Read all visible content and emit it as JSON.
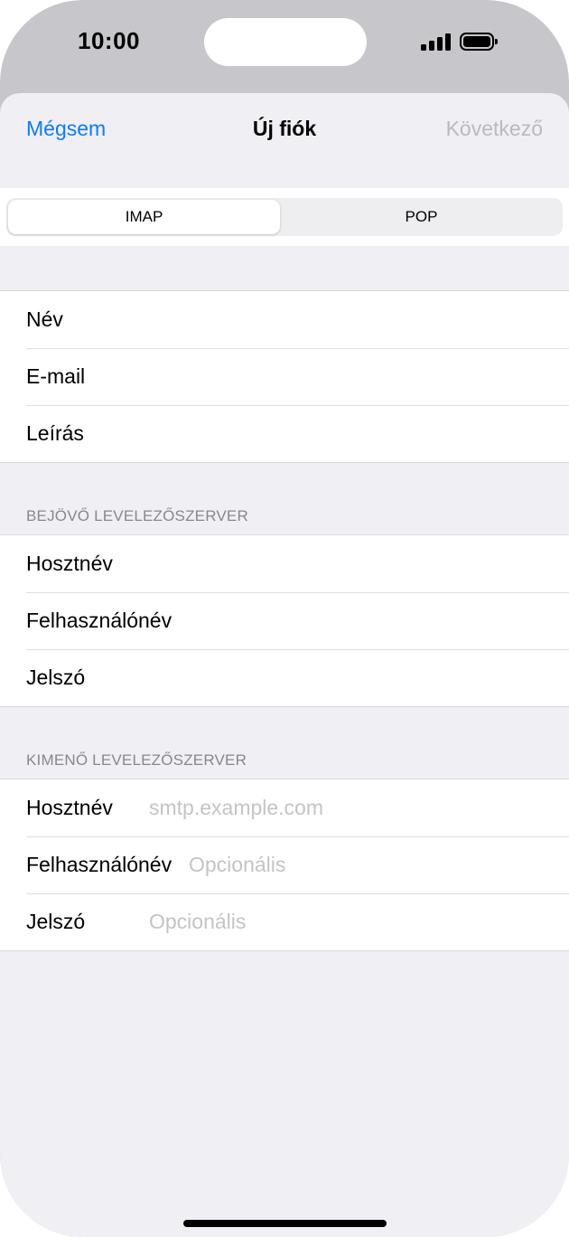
{
  "status_bar": {
    "time": "10:00"
  },
  "nav": {
    "cancel": "Mégsem",
    "title": "Új fiók",
    "next": "Következő"
  },
  "segmented": {
    "options": [
      "IMAP",
      "POP"
    ],
    "selected": "IMAP"
  },
  "account_fields": {
    "name": "Név",
    "email": "E-mail",
    "description": "Leírás"
  },
  "incoming": {
    "header": "BEJÖVŐ LEVELEZŐSZERVER",
    "hostname": "Hosztnév",
    "username": "Felhasználónév",
    "password": "Jelszó"
  },
  "outgoing": {
    "header": "KIMENŐ LEVELEZŐSZERVER",
    "hostname": "Hosztnév",
    "hostname_placeholder": "smtp.example.com",
    "username": "Felhasználónév",
    "username_placeholder": "Opcionális",
    "password": "Jelszó",
    "password_placeholder": "Opcionális"
  },
  "colors": {
    "accent": "#0a7cff",
    "disabled": "#b9b9be",
    "background": "#f0eff4"
  }
}
